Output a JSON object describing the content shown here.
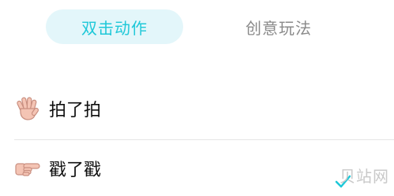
{
  "tabs": [
    {
      "label": "双击动作",
      "active": true
    },
    {
      "label": "创意玩法",
      "active": false
    }
  ],
  "actions": [
    {
      "label": "拍了拍",
      "icon": "waving-hand-icon"
    },
    {
      "label": "戳了戳",
      "icon": "pointing-hand-icon"
    }
  ],
  "watermark": "贝站网",
  "colors": {
    "accent": "#1ec8d8",
    "accent_bg": "#e3f6fa",
    "inactive_tab": "#8a8a8a",
    "skin": "#f4c4b4"
  }
}
